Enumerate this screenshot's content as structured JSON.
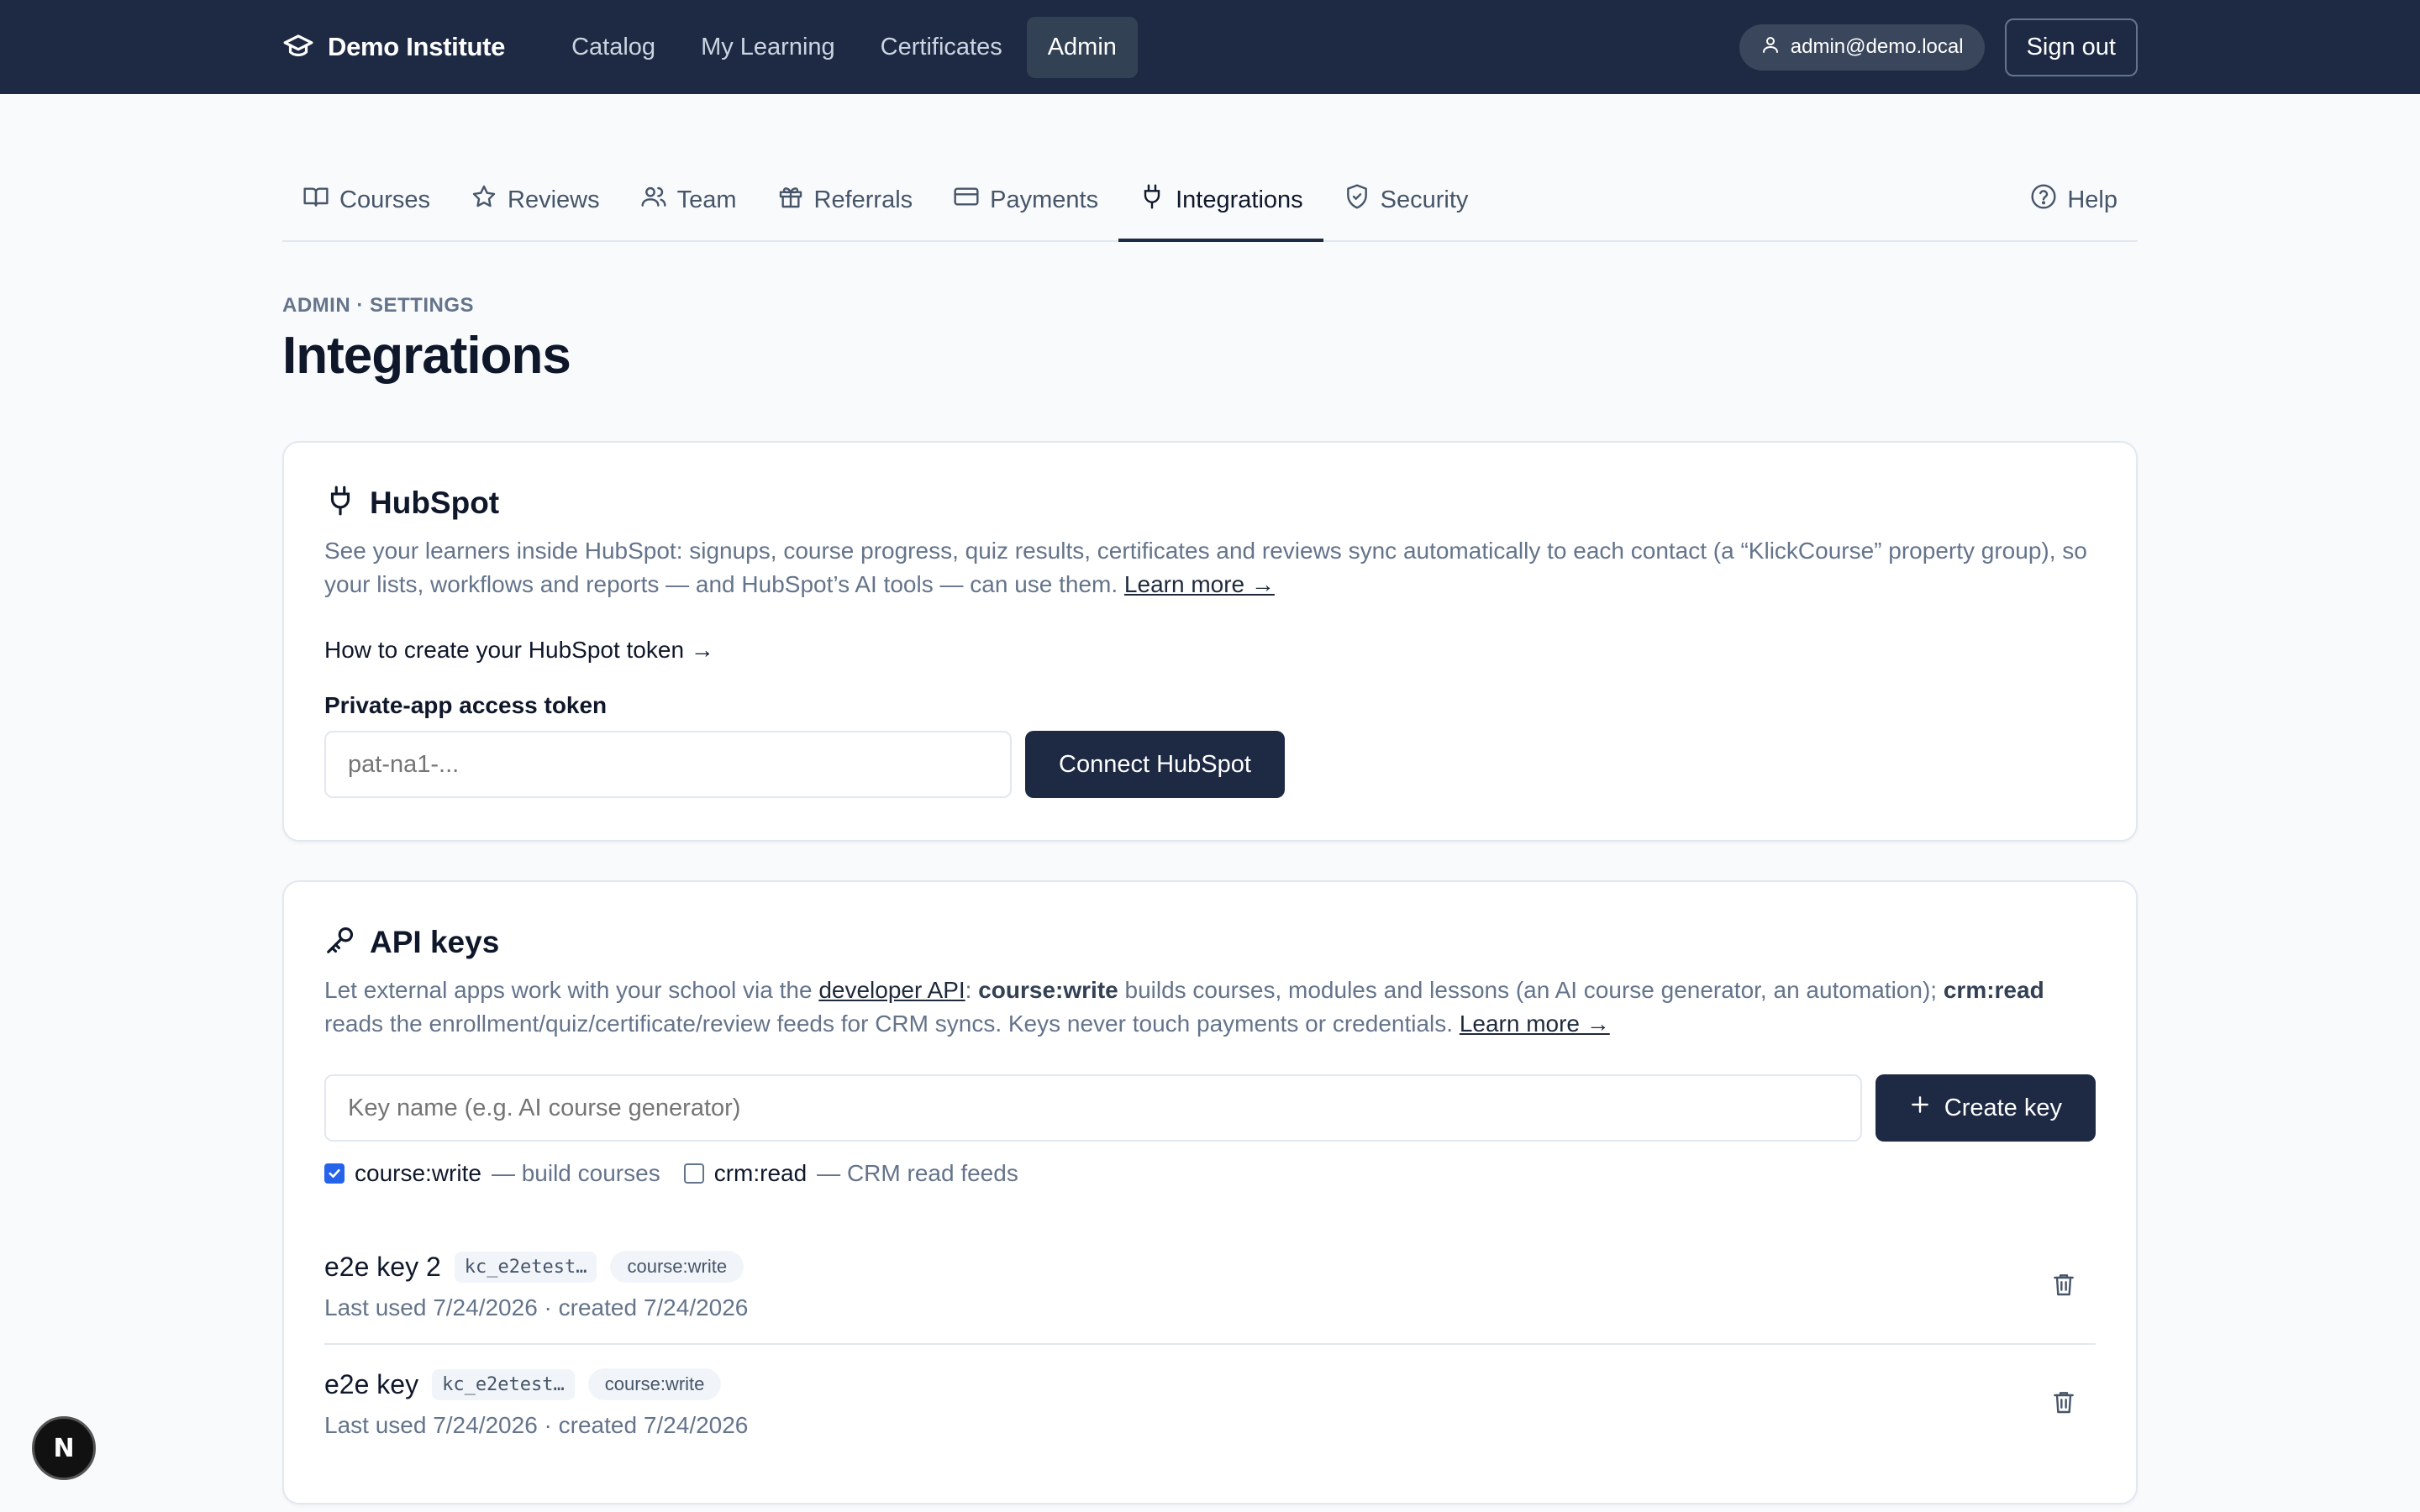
{
  "topbar": {
    "brand": "Demo Institute",
    "nav": [
      {
        "label": "Catalog",
        "active": false
      },
      {
        "label": "My Learning",
        "active": false
      },
      {
        "label": "Certificates",
        "active": false
      },
      {
        "label": "Admin",
        "active": true
      }
    ],
    "user_email": "admin@demo.local",
    "sign_out": "Sign out"
  },
  "tabs": [
    {
      "label": "Courses",
      "icon": "book-icon"
    },
    {
      "label": "Reviews",
      "icon": "star-icon"
    },
    {
      "label": "Team",
      "icon": "users-icon"
    },
    {
      "label": "Referrals",
      "icon": "gift-icon"
    },
    {
      "label": "Payments",
      "icon": "credit-card-icon"
    },
    {
      "label": "Integrations",
      "icon": "plug-icon",
      "active": true
    },
    {
      "label": "Security",
      "icon": "shield-icon"
    }
  ],
  "help_label": "Help",
  "breadcrumb": "ADMIN · SETTINGS",
  "page_title": "Integrations",
  "hubspot": {
    "title": "HubSpot",
    "desc_1": "See your learners inside HubSpot: signups, course progress, quiz results, certificates and reviews sync automatically to each contact (a “KlickCourse” property group), so your lists, workflows and reports — and HubSpot’s AI tools — can use them. ",
    "learn_more": "Learn more →",
    "howto": "How to create your HubSpot token →",
    "token_label": "Private-app access token",
    "token_placeholder": "pat-na1-...",
    "connect": "Connect HubSpot"
  },
  "api_keys": {
    "title": "API keys",
    "desc_a": "Let external apps work with your school via the ",
    "dev_api": "developer API",
    "desc_b": ": ",
    "scope_write": "course:write",
    "desc_c": " builds courses, modules and lessons (an AI course generator, an automation); ",
    "scope_read": "crm:read",
    "desc_d": " reads the enrollment/quiz/certificate/review feeds for CRM syncs. Keys never touch payments or credentials. ",
    "learn_more": "Learn more →",
    "name_placeholder": "Key name (e.g. AI course generator)",
    "create": "Create key",
    "scopes": [
      {
        "name": "course:write",
        "desc": "— build courses",
        "checked": true
      },
      {
        "name": "crm:read",
        "desc": "— CRM read feeds",
        "checked": false
      }
    ],
    "keys": [
      {
        "name": "e2e key 2",
        "prefix": "kc_e2etest…",
        "scope": "course:write",
        "meta": "Last used 7/24/2026 · created 7/24/2026"
      },
      {
        "name": "e2e key",
        "prefix": "kc_e2etest…",
        "scope": "course:write",
        "meta": "Last used 7/24/2026 · created 7/24/2026"
      }
    ]
  },
  "dev_badge": "N",
  "colors": {
    "nav_bg": "#1e2a44",
    "accent": "#1e2a44",
    "checkbox": "#2563eb"
  }
}
